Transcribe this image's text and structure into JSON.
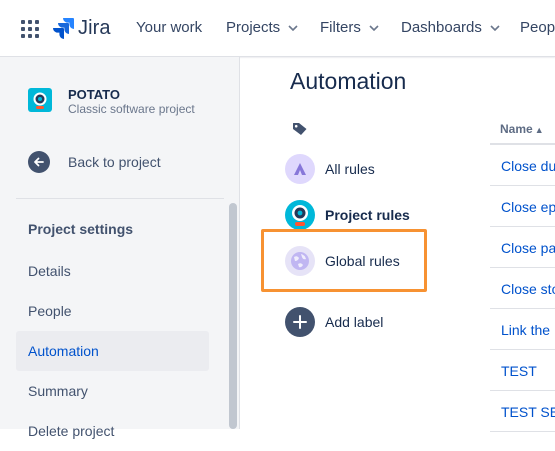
{
  "nav": {
    "logo_text": "Jira",
    "items": [
      {
        "label": "Your work",
        "dropdown": false
      },
      {
        "label": "Projects",
        "dropdown": true
      },
      {
        "label": "Filters",
        "dropdown": true
      },
      {
        "label": "Dashboards",
        "dropdown": true
      },
      {
        "label": "Peop",
        "dropdown": false
      }
    ]
  },
  "sidebar": {
    "project_name": "POTATO",
    "project_type": "Classic software project",
    "back_label": "Back to project",
    "section_title": "Project settings",
    "items": [
      {
        "label": "Details",
        "active": false
      },
      {
        "label": "People",
        "active": false
      },
      {
        "label": "Automation",
        "active": true
      },
      {
        "label": "Summary",
        "active": false
      },
      {
        "label": "Delete project",
        "active": false
      }
    ]
  },
  "main": {
    "title": "Automation",
    "labels": [
      {
        "label": "All rules",
        "icon": "atlassian-icon",
        "bold": false
      },
      {
        "label": "Project rules",
        "icon": "project-avatar-icon",
        "bold": true
      },
      {
        "label": "Global rules",
        "icon": "globe-icon",
        "bold": false
      },
      {
        "label": "Add label",
        "icon": "plus-icon",
        "bold": false
      }
    ],
    "table": {
      "column_header": "Name",
      "rows": [
        "Close du",
        "Close ep",
        "Close pa",
        "Close sto",
        "Link the",
        "TEST",
        "TEST SE"
      ]
    }
  },
  "colors": {
    "brand": "#0052cc",
    "highlight": "#f79232",
    "sidebar_bg": "#f4f5f7"
  }
}
